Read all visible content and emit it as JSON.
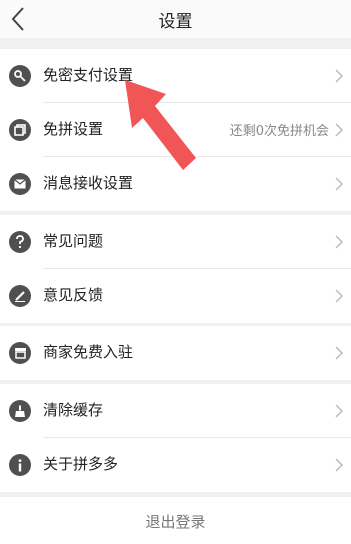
{
  "header": {
    "title": "设置"
  },
  "groups": [
    {
      "items": [
        {
          "label": "免密支付设置",
          "extra": ""
        },
        {
          "label": "免拼设置",
          "extra": "还剩0次免拼机会"
        },
        {
          "label": "消息接收设置",
          "extra": ""
        }
      ]
    },
    {
      "items": [
        {
          "label": "常见问题"
        },
        {
          "label": "意见反馈"
        }
      ]
    },
    {
      "items": [
        {
          "label": "商家免费入驻"
        }
      ]
    },
    {
      "items": [
        {
          "label": "清除缓存"
        },
        {
          "label": "关于拼多多"
        }
      ]
    }
  ],
  "logout": {
    "label": "退出登录"
  },
  "colors": {
    "icon": "#505050",
    "annotation_arrow": "#f04848",
    "background": "#f0f0f0"
  },
  "icons": [
    "key-icon",
    "copy-icon",
    "mail-icon",
    "question-icon",
    "pencil-icon",
    "store-icon",
    "broom-icon",
    "info-icon",
    "chevron-right-icon",
    "back-chevron-icon"
  ]
}
